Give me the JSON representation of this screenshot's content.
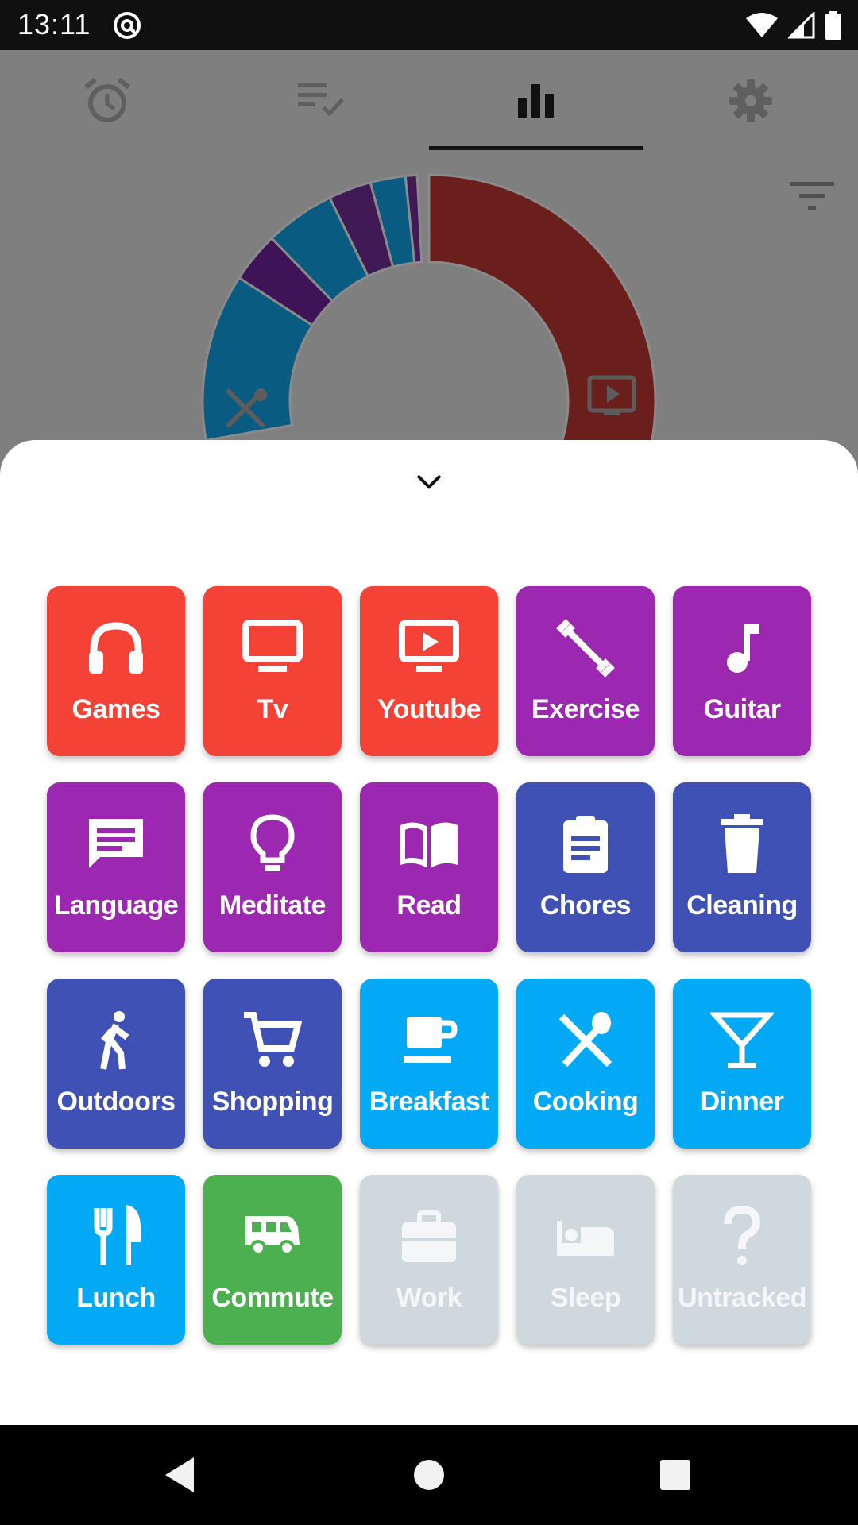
{
  "status_bar": {
    "time": "13:11",
    "icons": [
      "at-sign-icon",
      "wifi-icon",
      "signal-icon",
      "battery-icon"
    ]
  },
  "tabs": [
    {
      "name": "alarm-clock-icon",
      "selected": false
    },
    {
      "name": "checklist-icon",
      "selected": false
    },
    {
      "name": "bar-chart-icon",
      "selected": true
    },
    {
      "name": "gear-icon",
      "selected": false
    }
  ],
  "chart_data": {
    "type": "pie",
    "segments": [
      {
        "color": "#6a1f1c",
        "icon": "tv-play-icon"
      },
      {
        "color": "#3e1358",
        "icon": ""
      },
      {
        "color": "#0a5b82",
        "icon": ""
      },
      {
        "color": "#401a54",
        "icon": ""
      },
      {
        "color": "#0a5b82",
        "icon": ""
      },
      {
        "color": "#401a54",
        "icon": ""
      },
      {
        "color": "#0a5b82",
        "icon": "cooking-icon"
      }
    ]
  },
  "sheet": {
    "collapse_icon": "chevron-down-icon",
    "tiles": [
      {
        "label": "Games",
        "icon": "headphones-icon",
        "color": "#f44336"
      },
      {
        "label": "Tv",
        "icon": "monitor-icon",
        "color": "#f44336"
      },
      {
        "label": "Youtube",
        "icon": "youtube-tv-icon",
        "color": "#f44336"
      },
      {
        "label": "Exercise",
        "icon": "dumbbell-icon",
        "color": "#9c27b0"
      },
      {
        "label": "Guitar",
        "icon": "music-note-icon",
        "color": "#9c27b0"
      },
      {
        "label": "Language",
        "icon": "chat-message-icon",
        "color": "#9c27b0"
      },
      {
        "label": "Meditate",
        "icon": "lightbulb-icon",
        "color": "#9c27b0"
      },
      {
        "label": "Read",
        "icon": "open-book-icon",
        "color": "#9c27b0"
      },
      {
        "label": "Chores",
        "icon": "clipboard-icon",
        "color": "#3f51b5"
      },
      {
        "label": "Cleaning",
        "icon": "trash-can-icon",
        "color": "#3f51b5"
      },
      {
        "label": "Outdoors",
        "icon": "walking-person-icon",
        "color": "#3f51b5"
      },
      {
        "label": "Shopping",
        "icon": "shopping-cart-icon",
        "color": "#3f51b5"
      },
      {
        "label": "Breakfast",
        "icon": "coffee-cup-icon",
        "color": "#03a9f4"
      },
      {
        "label": "Cooking",
        "icon": "utensils-crossed-icon",
        "color": "#03a9f4"
      },
      {
        "label": "Dinner",
        "icon": "cocktail-glass-icon",
        "color": "#03a9f4"
      },
      {
        "label": "Lunch",
        "icon": "fork-knife-icon",
        "color": "#03a9f4"
      },
      {
        "label": "Commute",
        "icon": "van-icon",
        "color": "#4caf50"
      },
      {
        "label": "Work",
        "icon": "briefcase-icon",
        "color": "#cfd8dc"
      },
      {
        "label": "Sleep",
        "icon": "bed-icon",
        "color": "#cfd8dc"
      },
      {
        "label": "Untracked",
        "icon": "question-mark-icon",
        "color": "#cfd8dc"
      }
    ]
  },
  "nav_bar": {
    "buttons": [
      "back-icon",
      "home-icon",
      "recents-icon"
    ]
  }
}
